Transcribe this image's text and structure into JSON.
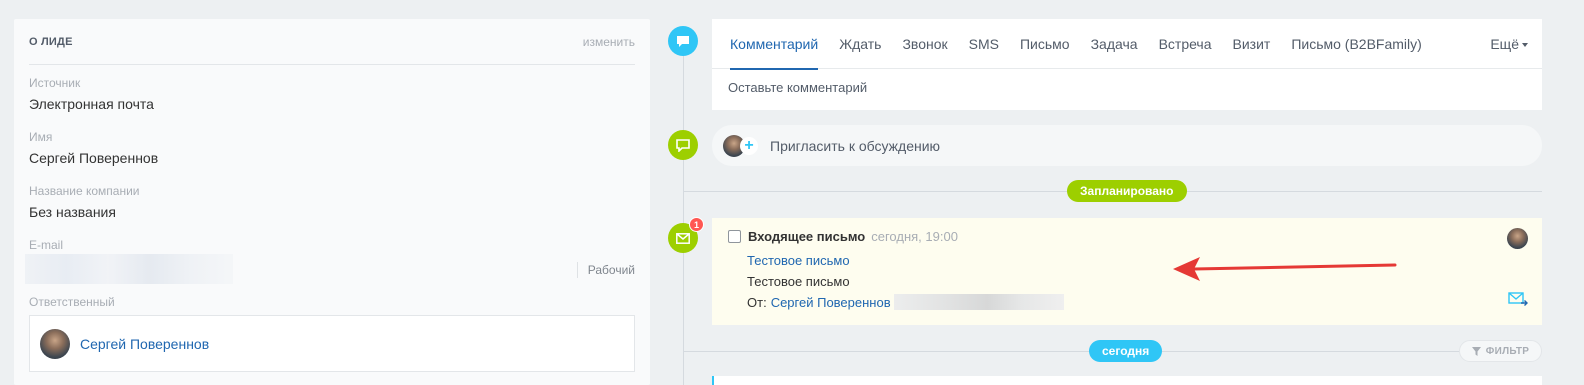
{
  "lead": {
    "title": "О ЛИДЕ",
    "edit_label": "изменить",
    "fields": [
      {
        "label": "Источник",
        "value": "Электронная почта"
      },
      {
        "label": "Имя",
        "value": "Сергей Повереннов"
      },
      {
        "label": "Название компании",
        "value": "Без названия"
      }
    ],
    "email": {
      "label": "E-mail",
      "type": "Рабочий"
    },
    "responsible": {
      "label": "Ответственный",
      "name": "Сергей Повереннов"
    }
  },
  "composer": {
    "tabs": [
      "Комментарий",
      "Ждать",
      "Звонок",
      "SMS",
      "Письмо",
      "Задача",
      "Встреча",
      "Визит",
      "Письмо (B2BFamily)"
    ],
    "active_tab": "Комментарий",
    "more_label": "Ещё",
    "placeholder": "Оставьте комментарий"
  },
  "invite": {
    "label": "Пригласить к обсуждению"
  },
  "planned_label": "Запланировано",
  "mail": {
    "title": "Входящее письмо",
    "time": "сегодня, 19:00",
    "subject": "Тестовое письмо",
    "body": "Тестовое письмо",
    "from_label": "От:",
    "from_name": "Сергей Повереннов",
    "badge_count": "1"
  },
  "today_label": "сегодня",
  "filter_label": "ФИЛЬТР",
  "colors": {
    "accent_blue": "#2fc6f6",
    "accent_green": "#9dcf00",
    "link": "#2067b0",
    "arrow": "#e53935"
  }
}
